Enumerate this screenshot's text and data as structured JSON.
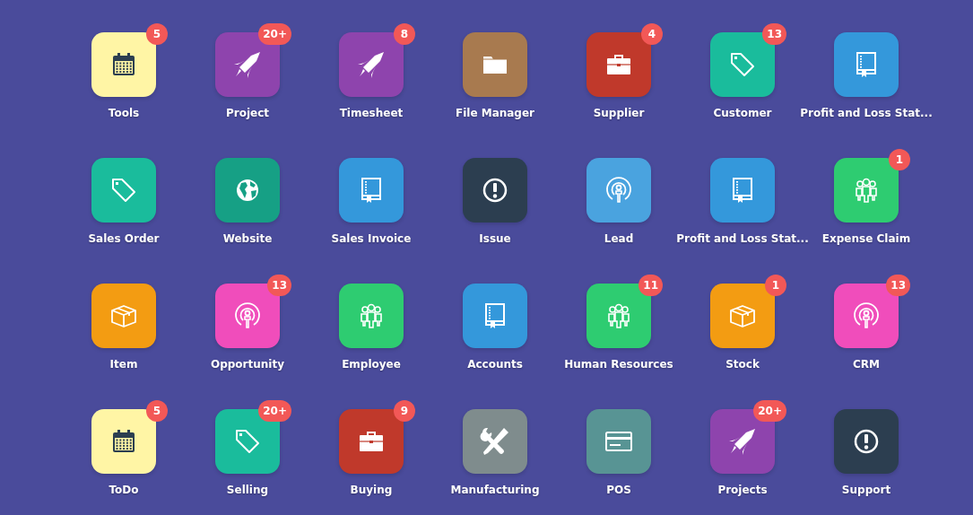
{
  "apps": [
    {
      "label": "Tools",
      "kind": "calendar",
      "color": "#fff5a5",
      "badge": "5"
    },
    {
      "label": "Project",
      "kind": "rocket",
      "color": "#8e44ad",
      "badge": "20+"
    },
    {
      "label": "Timesheet",
      "kind": "rocket",
      "color": "#8e44ad",
      "badge": "8"
    },
    {
      "label": "File Manager",
      "kind": "folder",
      "color": "#a87a4f"
    },
    {
      "label": "Supplier",
      "kind": "briefcase",
      "color": "#c0392b",
      "badge": "4"
    },
    {
      "label": "Customer",
      "kind": "tag",
      "color": "#1abc9c",
      "badge": "13"
    },
    {
      "label": "Profit and Loss Stat...",
      "kind": "book",
      "color": "#3498db"
    },
    {
      "label": "Sales Order",
      "kind": "tag",
      "color": "#1abc9c"
    },
    {
      "label": "Website",
      "kind": "globe",
      "color": "#16a085"
    },
    {
      "label": "Sales Invoice",
      "kind": "book",
      "color": "#3498db"
    },
    {
      "label": "Issue",
      "kind": "alert",
      "color": "#2c3e50"
    },
    {
      "label": "Lead",
      "kind": "podcast",
      "color": "#4aa3df"
    },
    {
      "label": "Profit and Loss Stat...",
      "kind": "book",
      "color": "#3498db"
    },
    {
      "label": "Expense Claim",
      "kind": "people",
      "color": "#2ecc71",
      "badge": "1"
    },
    {
      "label": "Item",
      "kind": "box",
      "color": "#f39c12"
    },
    {
      "label": "Opportunity",
      "kind": "podcast",
      "color": "#f04dbb",
      "badge": "13"
    },
    {
      "label": "Employee",
      "kind": "people",
      "color": "#2ecc71"
    },
    {
      "label": "Accounts",
      "kind": "book",
      "color": "#3498db"
    },
    {
      "label": "Human Resources",
      "kind": "people",
      "color": "#2ecc71",
      "badge": "11"
    },
    {
      "label": "Stock",
      "kind": "box",
      "color": "#f39c12",
      "badge": "1"
    },
    {
      "label": "CRM",
      "kind": "podcast",
      "color": "#f04dbb",
      "badge": "13"
    },
    {
      "label": "ToDo",
      "kind": "calendar",
      "color": "#fff5a5",
      "badge": "5"
    },
    {
      "label": "Selling",
      "kind": "tag",
      "color": "#1abc9c",
      "badge": "20+"
    },
    {
      "label": "Buying",
      "kind": "briefcase",
      "color": "#c0392b",
      "badge": "9"
    },
    {
      "label": "Manufacturing",
      "kind": "tools",
      "color": "#7f8c8d"
    },
    {
      "label": "POS",
      "kind": "card",
      "color": "#589494"
    },
    {
      "label": "Projects",
      "kind": "rocket",
      "color": "#8e44ad",
      "badge": "20+"
    },
    {
      "label": "Support",
      "kind": "alert",
      "color": "#2c3e50"
    }
  ]
}
